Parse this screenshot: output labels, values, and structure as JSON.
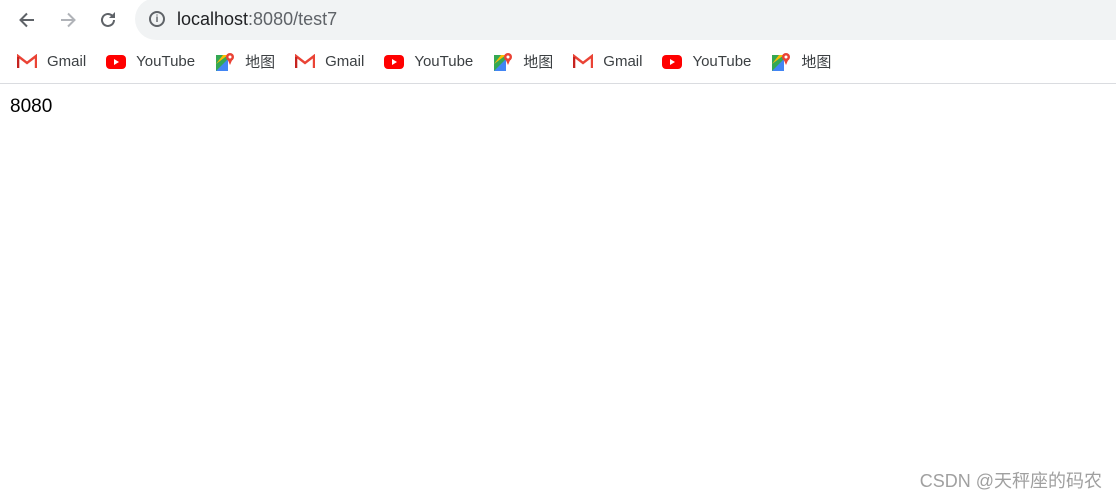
{
  "browser": {
    "address_host": "localhost",
    "address_path": ":8080/test7",
    "bookmarks": [
      {
        "label": "Gmail",
        "icon": "gmail-icon"
      },
      {
        "label": "YouTube",
        "icon": "youtube-icon"
      },
      {
        "label": "地图",
        "icon": "maps-icon"
      },
      {
        "label": "Gmail",
        "icon": "gmail-icon"
      },
      {
        "label": "YouTube",
        "icon": "youtube-icon"
      },
      {
        "label": "地图",
        "icon": "maps-icon"
      },
      {
        "label": "Gmail",
        "icon": "gmail-icon"
      },
      {
        "label": "YouTube",
        "icon": "youtube-icon"
      },
      {
        "label": "地图",
        "icon": "maps-icon"
      }
    ]
  },
  "page": {
    "body_text": "8080"
  },
  "watermark": "CSDN @天秤座的码农"
}
